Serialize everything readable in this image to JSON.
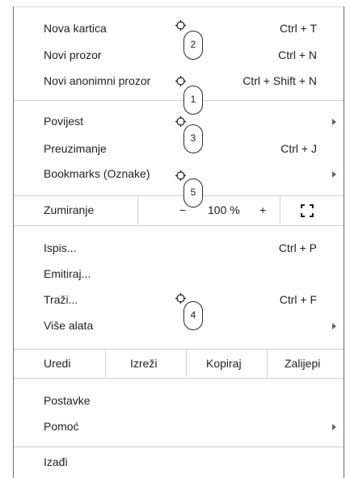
{
  "menu": {
    "items_group1": [
      {
        "label": "Nova kartica",
        "shortcut": "Ctrl + T"
      },
      {
        "label": "Novi prozor",
        "shortcut": "Ctrl + N"
      },
      {
        "label": "Novi anonimni prozor",
        "shortcut": "Ctrl + Shift + N"
      }
    ],
    "items_group2": [
      {
        "label": "Povijest",
        "shortcut": ""
      },
      {
        "label": "Preuzimanje",
        "shortcut": "Ctrl + J"
      },
      {
        "label": "Bookmarks (Oznake)",
        "shortcut": ""
      }
    ],
    "zoom": {
      "label": "Zumiranje",
      "minus": "−",
      "value": "100 %",
      "plus": "+"
    },
    "items_group3": [
      {
        "label": "Ispis...",
        "shortcut": "Ctrl + P"
      },
      {
        "label": "Emitiraj...",
        "shortcut": ""
      },
      {
        "label": "Traži...",
        "shortcut": "Ctrl + F"
      },
      {
        "label": "Više alata",
        "shortcut": ""
      }
    ],
    "edit": {
      "label": "Uredi",
      "cut": "Izreži",
      "copy": "Kopiraj",
      "paste": "Zalijepi"
    },
    "items_group4": [
      {
        "label": "Postavke",
        "shortcut": ""
      },
      {
        "label": "Pomoć",
        "shortcut": ""
      }
    ],
    "exit": {
      "label": "Izađi"
    }
  },
  "markers": [
    "2",
    "1",
    "3",
    "5",
    "4"
  ],
  "colors": {
    "text": "#202124",
    "separator": "#d0d0d0",
    "border": "#6b6b6b"
  }
}
